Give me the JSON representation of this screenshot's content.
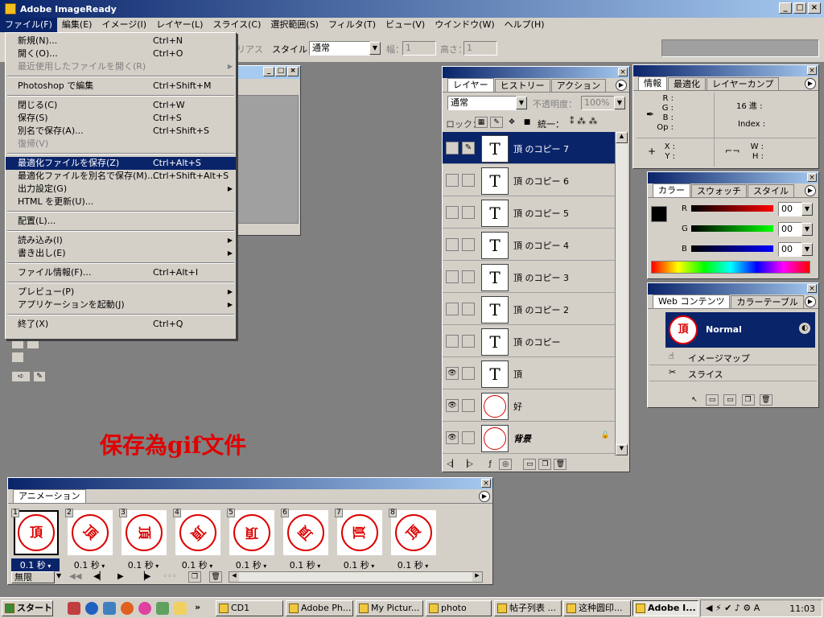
{
  "app": {
    "title": "Adobe ImageReady"
  },
  "menubar": [
    "ファイル(F)",
    "編集(E)",
    "イメージ(I)",
    "レイヤー(L)",
    "スライス(C)",
    "選択範囲(S)",
    "フィルタ(T)",
    "ビュー(V)",
    "ウインドウ(W)",
    "ヘルプ(H)"
  ],
  "optbar": {
    "antialias": "リアス",
    "style_label": "スタイル：",
    "style_value": "通常",
    "width_label": "幅：",
    "width_value": "1",
    "height_label": "高さ：",
    "height_value": "1"
  },
  "file_menu": [
    {
      "label": "新規(N)...",
      "shortcut": "Ctrl+N"
    },
    {
      "label": "開く(O)...",
      "shortcut": "Ctrl+O"
    },
    {
      "label": "最近使用したファイルを開く(R)",
      "shortcut": "",
      "disabled": true,
      "sub": true
    },
    {
      "sep": true
    },
    {
      "label": "Photoshop で編集",
      "shortcut": "Ctrl+Shift+M"
    },
    {
      "sep": true
    },
    {
      "label": "閉じる(C)",
      "shortcut": "Ctrl+W"
    },
    {
      "label": "保存(S)",
      "shortcut": "Ctrl+S"
    },
    {
      "label": "別名で保存(A)...",
      "shortcut": "Ctrl+Shift+S"
    },
    {
      "label": "復帰(V)",
      "shortcut": "",
      "disabled": true
    },
    {
      "sep": true
    },
    {
      "label": "最適化ファイルを保存(Z)",
      "shortcut": "Ctrl+Alt+S",
      "highlight": true
    },
    {
      "label": "最適化ファイルを別名で保存(M)...",
      "shortcut": "Ctrl+Shift+Alt+S"
    },
    {
      "label": "出力設定(G)",
      "shortcut": "",
      "sub": true
    },
    {
      "label": "HTML を更新(U)...",
      "shortcut": ""
    },
    {
      "sep": true
    },
    {
      "label": "配置(L)...",
      "shortcut": ""
    },
    {
      "sep": true
    },
    {
      "label": "読み込み(I)",
      "shortcut": "",
      "sub": true
    },
    {
      "label": "書き出し(E)",
      "shortcut": "",
      "sub": true
    },
    {
      "sep": true
    },
    {
      "label": "ファイル情報(F)...",
      "shortcut": "Ctrl+Alt+I"
    },
    {
      "sep": true
    },
    {
      "label": "プレビュー(P)",
      "shortcut": "",
      "sub": true
    },
    {
      "label": "アプリケーションを起動(J)",
      "shortcut": "",
      "sub": true
    },
    {
      "sep": true
    },
    {
      "label": "終了(X)",
      "shortcut": "Ctrl+Q"
    }
  ],
  "layers_panel": {
    "tabs": [
      "レイヤー",
      "ヒストリー",
      "アクション"
    ],
    "blend_mode": "通常",
    "opacity_label": "不透明度：",
    "opacity_value": "100%",
    "lock_label": "ロック：",
    "unify_label": "統一：",
    "layers": [
      {
        "name": "頂 のコピー 7",
        "thumb": "T",
        "selected": true,
        "visible": false
      },
      {
        "name": "頂 のコピー 6",
        "thumb": "T",
        "visible": false
      },
      {
        "name": "頂 のコピー 5",
        "thumb": "T",
        "visible": false
      },
      {
        "name": "頂 のコピー 4",
        "thumb": "T",
        "visible": false
      },
      {
        "name": "頂 のコピー 3",
        "thumb": "T",
        "visible": false
      },
      {
        "name": "頂 のコピー 2",
        "thumb": "T",
        "visible": false
      },
      {
        "name": "頂 のコピー",
        "thumb": "T",
        "visible": false
      },
      {
        "name": "頂",
        "thumb": "T",
        "visible": true
      },
      {
        "name": "好",
        "thumb": "",
        "visible": true
      },
      {
        "name": "背景",
        "thumb": "",
        "visible": true
      }
    ]
  },
  "info_panel": {
    "tabs": [
      "情報",
      "最適化",
      "レイヤーカンプ"
    ],
    "r": "R :",
    "g": "G :",
    "b": "B :",
    "op": "Op :",
    "hex_label": "16 進 :",
    "index_label": "Index :",
    "x": "X :",
    "y": "Y :",
    "w": "W :",
    "h": "H :"
  },
  "color_panel": {
    "tabs": [
      "カラー",
      "スウォッチ",
      "スタイル"
    ],
    "r_label": "R",
    "g_label": "G",
    "b_label": "B",
    "r_value": "00",
    "g_value": "00",
    "b_value": "00"
  },
  "web_panel": {
    "tabs": [
      "Web コンテンツ",
      "カラーテーブル"
    ],
    "normal_label": "Normal",
    "image_map_label": "イメージマップ",
    "slice_label": "スライス"
  },
  "caption": "保存為gif文件",
  "animation_panel": {
    "tab": "アニメーション",
    "loop": "無限",
    "stamp_glyph": "頂",
    "frames": [
      {
        "num": "1",
        "delay": "0.1 秒",
        "selected": true
      },
      {
        "num": "2",
        "delay": "0.1 秒"
      },
      {
        "num": "3",
        "delay": "0.1 秒"
      },
      {
        "num": "4",
        "delay": "0.1 秒"
      },
      {
        "num": "5",
        "delay": "0.1 秒"
      },
      {
        "num": "6",
        "delay": "0.1 秒"
      },
      {
        "num": "7",
        "delay": "0.1 秒"
      },
      {
        "num": "8",
        "delay": "0.1 秒"
      }
    ]
  },
  "taskbar": {
    "start": "スタート",
    "buttons": [
      {
        "label": "CD1"
      },
      {
        "label": "Adobe Ph..."
      },
      {
        "label": "My Pictur..."
      },
      {
        "label": "photo"
      },
      {
        "label": "帖子列表 ..."
      },
      {
        "label": "这种圆印..."
      },
      {
        "label": "Adobe I...",
        "active": true
      }
    ],
    "clock": "11:03"
  }
}
